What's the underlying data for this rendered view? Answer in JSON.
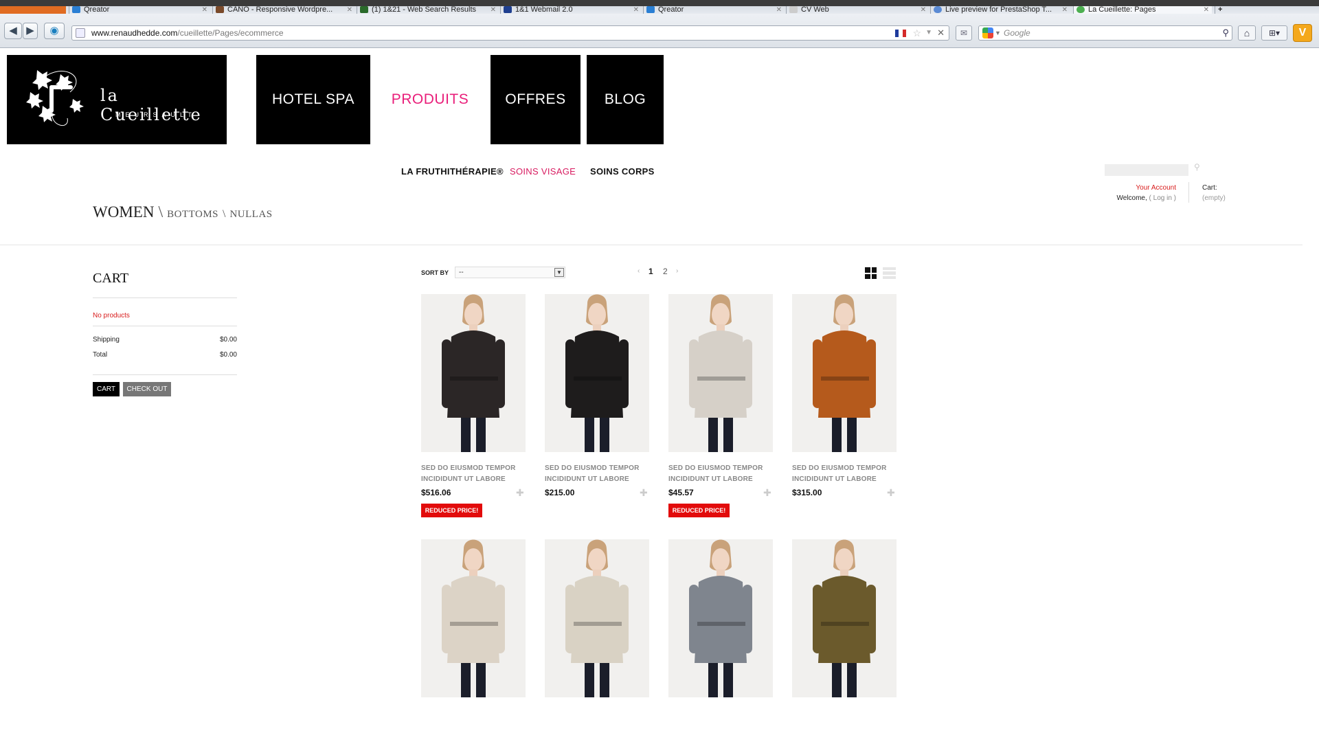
{
  "browser": {
    "tabs": [
      {
        "title": ""
      },
      {
        "title": "Qreator"
      },
      {
        "title": "CANO - Responsive Wordpre..."
      },
      {
        "title": "(1) 1&21 - Web Search Results"
      },
      {
        "title": "1&1 Webmail 2.0"
      },
      {
        "title": "Qreator"
      },
      {
        "title": "CV Web"
      },
      {
        "title": "Live preview for PrestaShop T..."
      },
      {
        "title": "La Cueillette: Pages"
      }
    ],
    "url_domain": "www.renaudhedde.com",
    "url_path": "/cueillette/Pages/ecommerce",
    "search_placeholder": "Google",
    "icons": {
      "back": "back-arrow-icon",
      "forward": "forward-arrow-icon",
      "star": "star-icon",
      "stop": "close-icon",
      "search": "magnifier-icon",
      "home": "home-icon"
    }
  },
  "site": {
    "logo": {
      "brand": "la Cueillette",
      "place": "MEURSAULT"
    },
    "main_nav": [
      {
        "label": "HOTEL SPA",
        "active": false
      },
      {
        "label": "PRODUITS",
        "active": true
      },
      {
        "label": "OFFRES",
        "active": false
      },
      {
        "label": "BLOG",
        "active": false
      }
    ],
    "sub_nav": [
      {
        "label": "LA FRUTHITHÉRAPIE®",
        "active": false
      },
      {
        "label": "SOINS VISAGE",
        "active": true
      },
      {
        "label": "SOINS CORPS",
        "active": false
      }
    ],
    "account": {
      "title": "Your Account",
      "welcome": "Welcome,",
      "login": "( Log in )",
      "cart_label": "Cart:",
      "cart_state": "(empty)"
    },
    "breadcrumb": {
      "level1": "WOMEN",
      "sep": "\\",
      "level2": "BOTTOMS",
      "level3": "NULLAS"
    },
    "accent_color": "#e91e7a"
  },
  "cart": {
    "title": "CART",
    "no_products": "No products",
    "shipping_label": "Shipping",
    "shipping_value": "$0.00",
    "total_label": "Total",
    "total_value": "$0.00",
    "cart_button": "CART",
    "checkout_button": "CHECK OUT"
  },
  "listing": {
    "sort_label": "SORT BY",
    "sort_value": "--",
    "pages": [
      "1",
      "2"
    ],
    "current_page": "1",
    "prev": "‹",
    "next": "›",
    "products": [
      {
        "name": "SED DO EIUSMOD TEMPOR INCIDIDUNT UT LABORE",
        "price": "$516.06",
        "badge": "REDUCED PRICE!",
        "coat_color": "#2b2626"
      },
      {
        "name": "SED DO EIUSMOD TEMPOR INCIDIDUNT UT LABORE",
        "price": "$215.00",
        "badge": "",
        "coat_color": "#1e1c1c"
      },
      {
        "name": "SED DO EIUSMOD TEMPOR INCIDIDUNT UT LABORE",
        "price": "$45.57",
        "badge": "REDUCED PRICE!",
        "coat_color": "#d6d0c8"
      },
      {
        "name": "SED DO EIUSMOD TEMPOR INCIDIDUNT UT LABORE",
        "price": "$315.00",
        "badge": "",
        "coat_color": "#b55a1c"
      },
      {
        "name": "",
        "price": "",
        "badge": "",
        "coat_color": "#dcd3c6"
      },
      {
        "name": "",
        "price": "",
        "badge": "",
        "coat_color": "#d9d2c4"
      },
      {
        "name": "",
        "price": "",
        "badge": "",
        "coat_color": "#7f858e"
      },
      {
        "name": "",
        "price": "",
        "badge": "",
        "coat_color": "#6b5a2c"
      }
    ]
  }
}
